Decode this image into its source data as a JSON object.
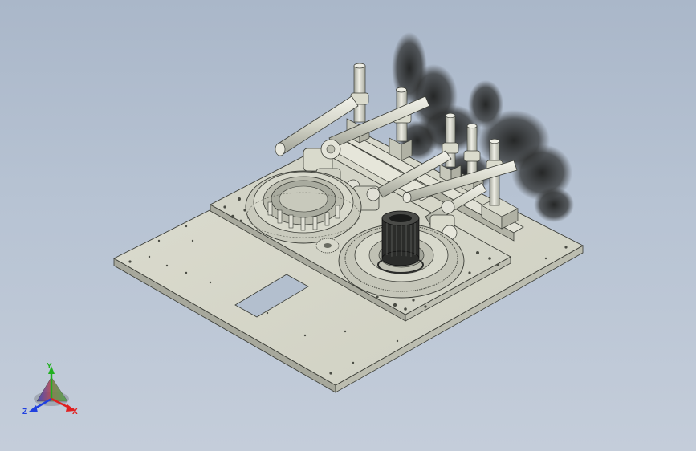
{
  "viewport": {
    "background_top": "#aab7c9",
    "background_bottom": "#c4cdda",
    "model_color": "#d6d7ca",
    "edge_color": "#3a3c36"
  },
  "triad": {
    "x_label": "X",
    "y_label": "Y",
    "z_label": "Z",
    "x_color": "#e02020",
    "y_color": "#20b020",
    "z_color": "#2040e0"
  }
}
